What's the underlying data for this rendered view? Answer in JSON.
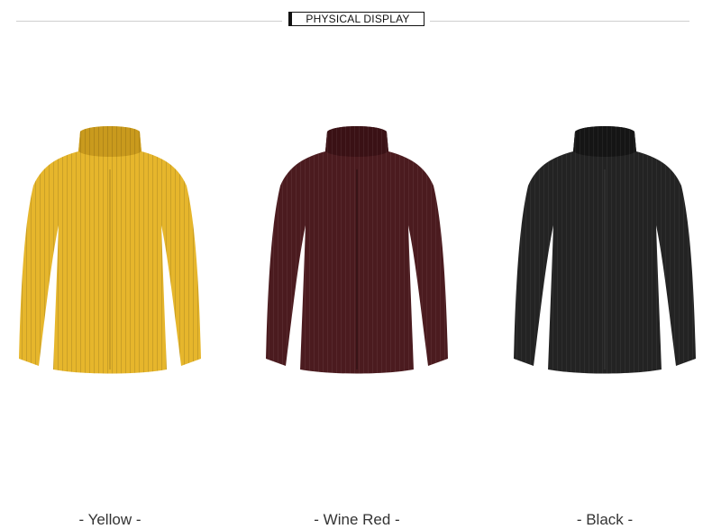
{
  "header": {
    "title": "PHYSICAL DISPLAY"
  },
  "products": [
    {
      "caption": "- Yellow -",
      "color": "#E6B62C",
      "shade": "#C99A1D"
    },
    {
      "caption": "- Wine Red -",
      "color": "#4B1B1F",
      "shade": "#3A1115"
    },
    {
      "caption": "- Black -",
      "color": "#232323",
      "shade": "#151515"
    }
  ]
}
